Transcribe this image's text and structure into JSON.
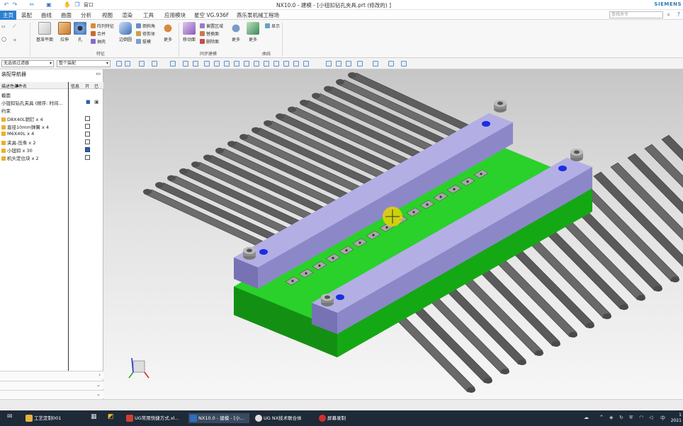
{
  "titlebar": {
    "quick_access_label": "窗口",
    "title": "NX10.0 - 建模 - [小钮扣钻孔夹具.prt  (修改的) ]",
    "brand": "SIEMENS"
  },
  "menubar": {
    "items": [
      "主页",
      "装配",
      "曲线",
      "曲面",
      "分析",
      "视图",
      "渲染",
      "工具",
      "应用模块",
      "星空 VG.936F",
      "燕乐泵机械工程场"
    ],
    "search_placeholder": "查找命令"
  },
  "ribbon": {
    "buttons": [
      {
        "label": "基准平面"
      },
      {
        "label": "拉伸"
      },
      {
        "label": "孔"
      },
      {
        "label": "边倒圆"
      },
      {
        "label": "更多"
      },
      {
        "label": "移动面"
      },
      {
        "label": "更多"
      },
      {
        "label": "更多"
      }
    ],
    "small_items": [
      "阵列特征",
      "合并",
      "抽壳",
      "倒斜角",
      "修剪体",
      "拔模",
      "偏置区域",
      "替换面",
      "删除面",
      "显示"
    ],
    "groups": [
      "特征",
      "同步建模",
      "曲线"
    ]
  },
  "filterbar": {
    "type_filter": "无选择过滤器",
    "scope_filter": "整个装配"
  },
  "navigator": {
    "title": "装配导航器",
    "columns": [
      "描述性部件名",
      "信息",
      "只",
      "已"
    ],
    "section_label": "截面",
    "root_item": "小钮扣钻孔夹具 (顺序: 时间...",
    "constraints_label": "约束",
    "children": [
      {
        "label": "D8X40L销钉 x 4",
        "saved": false
      },
      {
        "label": "直径10mm弹簧 x 4",
        "saved": false
      },
      {
        "label": "M6X40L x 4",
        "saved": false
      },
      {
        "label": "夹具-压条 x 2",
        "saved": false
      },
      {
        "label": "小钮扣 x 30",
        "saved": true
      },
      {
        "label": "机头定位块 x 2",
        "saved": false
      }
    ]
  },
  "taskbar": {
    "items": [
      {
        "label": "工艺定制001",
        "color": "#e8b040"
      },
      {
        "label": "UG常用快捷方式.xl...",
        "color": "#d04030"
      },
      {
        "label": "NX10.0 - 建模 - [小...",
        "color": "#2f6fc0"
      },
      {
        "label": "UG NX技术联合体",
        "color": "#e0e0e0"
      },
      {
        "label": "屏幕录制",
        "color": "#d03030"
      }
    ],
    "tray_text": "中",
    "clock_time": "1",
    "clock_year": "2021"
  },
  "colors": {
    "accent": "#2d7fd0",
    "clamp_bar": "#9c98d4",
    "base_plate": "#1fbf1f",
    "conveyor": "#5a5a5a"
  }
}
